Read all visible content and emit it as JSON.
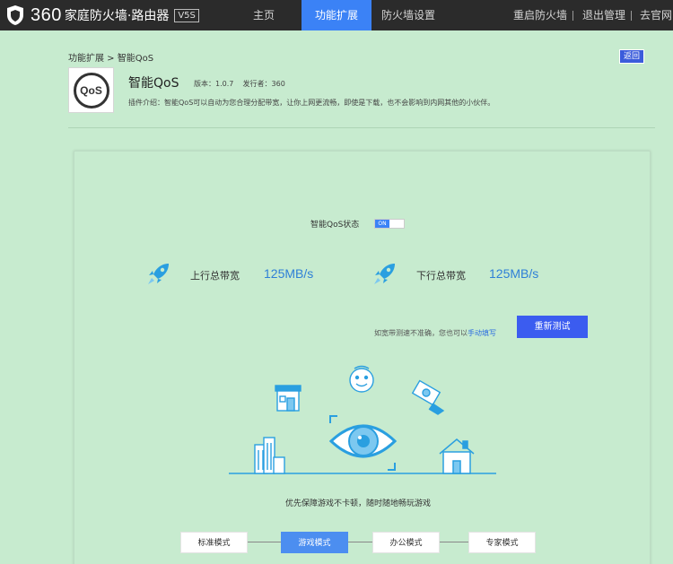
{
  "brand": {
    "logo_text": "360",
    "name": "家庭防火墙·路由器",
    "version": "V5S"
  },
  "nav": {
    "items": [
      {
        "label": "主页",
        "active": false
      },
      {
        "label": "功能扩展",
        "active": true
      },
      {
        "label": "防火墙设置",
        "active": false
      }
    ],
    "right": [
      "重启防火墙",
      "退出管理",
      "去官网"
    ]
  },
  "breadcrumb": "功能扩展 > 智能QoS",
  "back_label": "返回",
  "plugin": {
    "logo_text": "QoS",
    "title": "智能QoS",
    "version": "版本：1.0.7",
    "publisher": "发行者：360",
    "description": "插件介绍：智能QoS可以自动为您合理分配带宽，让你上网更流畅，即使是下载，也不会影响到内网其他的小伙伴。"
  },
  "qos": {
    "status_label": "智能QoS状态",
    "toggle_text": "ON",
    "enabled": true,
    "upload_label": "上行总带宽",
    "upload_value": "125MB/s",
    "download_label": "下行总带宽",
    "download_value": "125MB/s",
    "retest_note": "如宽带测速不准确，您也可以",
    "retest_link": "手动填写",
    "retest_button": "重新测试"
  },
  "caption": "优先保障游戏不卡顿，随时随地畅玩游戏",
  "modes": [
    {
      "label": "标准模式",
      "active": false
    },
    {
      "label": "游戏模式",
      "active": true
    },
    {
      "label": "办公模式",
      "active": false
    },
    {
      "label": "专家模式",
      "active": false
    }
  ],
  "colors": {
    "accent": "#3b82f6",
    "background": "#c7ebcf",
    "topbar": "#2b2b2b",
    "value_text": "#2e7fd7"
  }
}
